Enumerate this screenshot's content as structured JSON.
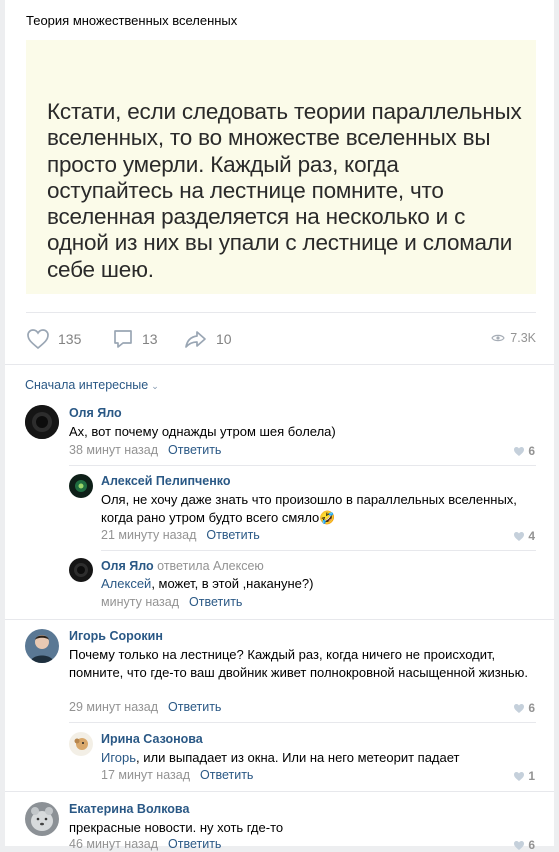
{
  "post": {
    "title": "Теория множественных вселенных",
    "quote": "Кстати, если следовать теории параллельных вселенных, то во множестве вселенных вы просто умерли. Каждый раз, когда оступайтесь на лестнице помните, что вселенная разделяется на несколько и с одной из них вы упали с лестнице и сломали себе шею.",
    "likes": "135",
    "comments": "13",
    "shares": "10",
    "views": "7.3K"
  },
  "comments_sort": "Сначала интересные",
  "reply_label": "Ответить",
  "comments": [
    {
      "author": "Оля Яло",
      "text": "Ах, вот почему однажды утром шея болела)",
      "time": "38 минут назад",
      "likes": "6"
    },
    {
      "author": "Алексей Пелипченко",
      "text": "Оля, не хочу даже знать что произошло в параллельных вселенных, когда рано утром будто всего смяло",
      "emoji": "🤣",
      "time": "21 минуту назад",
      "likes": "4"
    },
    {
      "author": "Оля Яло",
      "reply_to": "ответила Алексею",
      "mention": "Алексей",
      "text": ", может, в этой ,накануне?)",
      "time": "минуту назад",
      "likes": ""
    },
    {
      "author": "Игорь Сорокин",
      "text": "Почему только на лестнице? Каждый раз, когда ничего не происходит, помните, что где-то ваш двойник живет полнокровной насыщенной жизнью.",
      "time": "29 минут назад",
      "likes": "6"
    },
    {
      "author": "Ирина Сазонова",
      "mention": "Игорь",
      "text": ", или выпадает из окна. Или на него метеорит падает",
      "time": "17 минут назад",
      "likes": "1"
    },
    {
      "author": "Екатерина Волкова",
      "text": "прекрасные новости. ну хоть где-то",
      "time": "46 минут назад",
      "likes": "6"
    }
  ],
  "colors": {
    "link": "#2a5885",
    "muted": "#939393",
    "quote_bg": "#fbfbe9",
    "page_bg": "#edeef0"
  },
  "icons": [
    "heart-icon",
    "comment-icon",
    "share-icon",
    "eye-icon",
    "chevron-down-icon",
    "small-heart-icon"
  ]
}
